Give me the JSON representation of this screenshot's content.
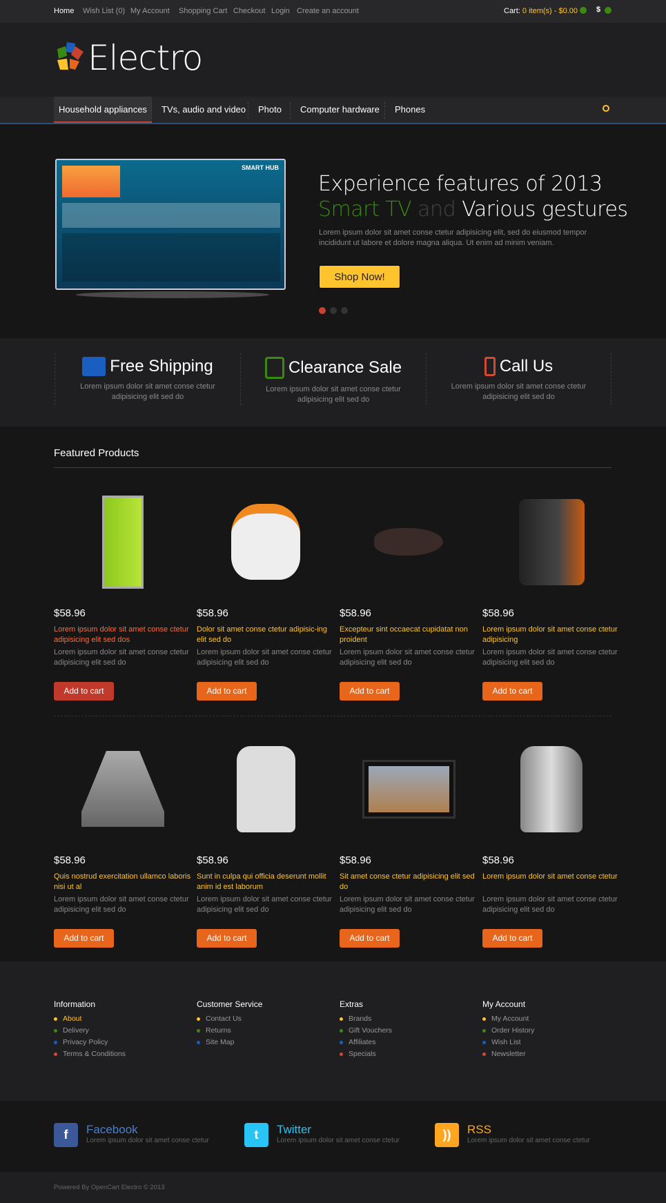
{
  "topbar": {
    "links": [
      "Home",
      "Wish List (0)",
      "My Account",
      "Shopping Cart",
      "Checkout",
      "Login",
      "Create an account"
    ],
    "cart_label": "Cart:",
    "cart_value": "0 item(s) - $0.00",
    "currency": "$"
  },
  "logo": {
    "text": "Electro"
  },
  "nav": {
    "items": [
      "Household appliances",
      "TVs, audio and video",
      "Photo",
      "Computer hardware",
      "Phones"
    ]
  },
  "slider": {
    "line1": "Experience features of 2013",
    "smart": "Smart TV",
    "and": " and ",
    "various": "Various gestures",
    "text": "Lorem ipsum dolor sit amet conse ctetur adipisicing elit, sed do eiusmod tempor incididunt ut labore et dolore magna aliqua. Ut enim ad minim veniam.",
    "button": "Shop Now!",
    "active_slide": 1,
    "slide_count": 3,
    "tv_label": "SMART HUB"
  },
  "features": [
    {
      "title": "Free Shipping",
      "text": "Lorem ipsum dolor sit amet conse ctetur adipisicing elit sed do",
      "icon": "truck-icon",
      "color": "#1a5fbf"
    },
    {
      "title": "Clearance Sale",
      "text": "Lorem ipsum dolor sit amet conse ctetur adipisicing elit sed do",
      "icon": "thumbs-up-icon",
      "color": "#3a8a12"
    },
    {
      "title": "Call Us",
      "text": "Lorem ipsum dolor sit amet conse ctetur adipisicing elit sed do",
      "icon": "phone-icon",
      "color": "#d24a32"
    }
  ],
  "featured": {
    "title": "Featured Products",
    "add_label": "Add to cart",
    "products": [
      {
        "price": "$58.96",
        "name": "Lorem ipsum dolor sit amet conse ctetur adipisicing elit sed dos",
        "desc": "Lorem ipsum dolor sit amet conse ctetur adipisicing elit sed do"
      },
      {
        "price": "$58.96",
        "name": "Dolor sit amet conse ctetur adipisic-ing elit sed do",
        "desc": "Lorem ipsum dolor sit amet conse ctetur adipisicing elit sed do"
      },
      {
        "price": "$58.96",
        "name": "Excepteur sint occaecat cupidatat non proident",
        "desc": "Lorem ipsum dolor sit amet conse ctetur adipisicing elit sed do"
      },
      {
        "price": "$58.96",
        "name": "Lorem ipsum dolor sit amet conse ctetur adipisicing",
        "desc": "Lorem ipsum dolor sit amet conse ctetur adipisicing elit sed do"
      },
      {
        "price": "$58.96",
        "name": "Quis nostrud exercitation ullamco laboris nisi ut al",
        "desc": "Lorem ipsum dolor sit amet conse ctetur adipisicing elit sed do"
      },
      {
        "price": "$58.96",
        "name": "Sunt in culpa qui officia deserunt mollit anim id est laborum",
        "desc": "Lorem ipsum dolor sit amet conse ctetur adipisicing elit sed do"
      },
      {
        "price": "$58.96",
        "name": "Sit amet conse ctetur adipisicing elit sed do",
        "desc": "Lorem ipsum dolor sit amet conse ctetur adipisicing elit sed do"
      },
      {
        "price": "$58.96",
        "name": "Lorem ipsum dolor sit amet conse ctetur",
        "desc": "Lorem ipsum dolor sit amet conse ctetur adipisicing elit sed do"
      }
    ]
  },
  "footer": {
    "columns": [
      {
        "title": "Information",
        "links": [
          "About",
          "Delivery",
          "Privacy Policy",
          "Terms & Conditions"
        ]
      },
      {
        "title": "Customer Service",
        "links": [
          "Contact Us",
          "Returns",
          "Site Map"
        ]
      },
      {
        "title": "Extras",
        "links": [
          "Brands",
          "Gift Vouchers",
          "Affiliates",
          "Specials"
        ]
      },
      {
        "title": "My Account",
        "links": [
          "My Account",
          "Order History",
          "Wish List",
          "Newsletter"
        ]
      }
    ],
    "dot_colors": [
      "#ffc32d",
      "#3a8a12",
      "#1a5fbf",
      "#d24a32"
    ]
  },
  "social": [
    {
      "name": "Facebook",
      "text": "Lorem ipsum dolor sit amet conse ctetur",
      "icon": "facebook-icon",
      "color": "#3b5998",
      "text_color": "#4a7fd0"
    },
    {
      "name": "Twitter",
      "text": "Lorem ipsum dolor sit amet conse ctetur",
      "icon": "twitter-icon",
      "color": "#27c4f5",
      "text_color": "#27c4f5"
    },
    {
      "name": "RSS",
      "text": "Lorem ipsum dolor sit amet conse ctetur",
      "icon": "rss-icon",
      "color": "#ffa51f",
      "text_color": "#ffa51f"
    }
  ],
  "copyright": "Powered By OpenCart Electro © 2013"
}
